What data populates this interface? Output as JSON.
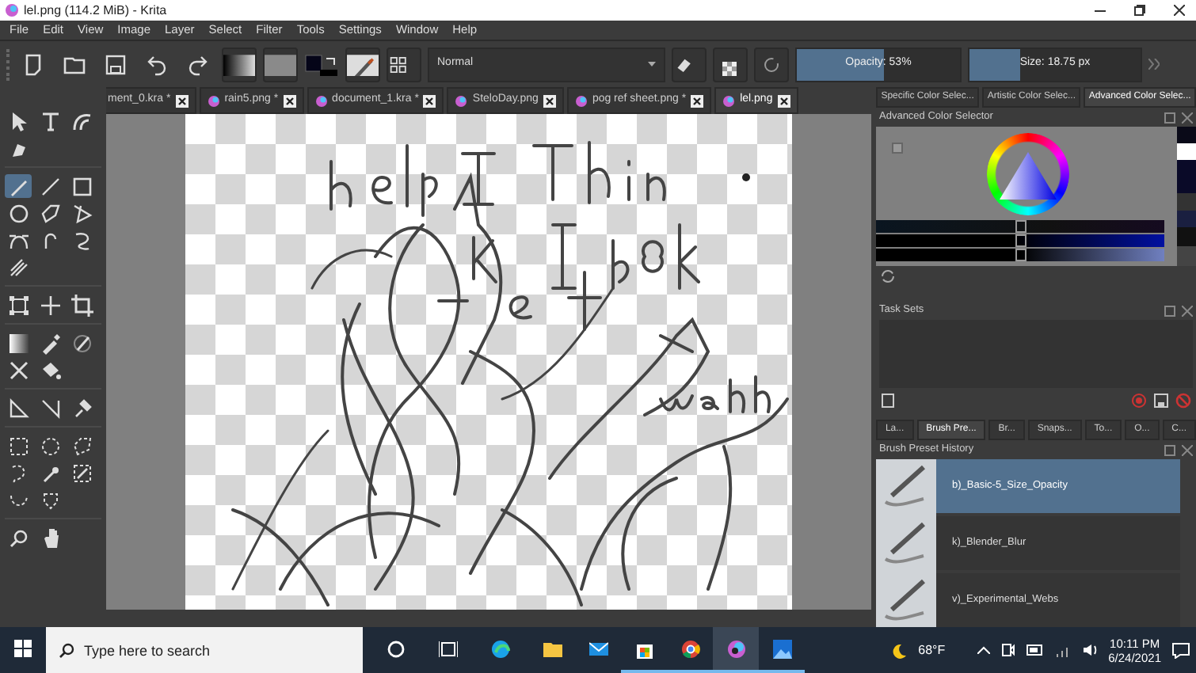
{
  "window": {
    "title": "lel.png (114.2 MiB)  - Krita"
  },
  "menu": [
    "File",
    "Edit",
    "View",
    "Image",
    "Layer",
    "Select",
    "Filter",
    "Tools",
    "Settings",
    "Window",
    "Help"
  ],
  "toolbar": {
    "blend_mode": "Normal",
    "opacity": {
      "label": "Opacity: 53%",
      "level": 0.53
    },
    "size": {
      "label": "Size: 18.75 px",
      "level": 0.3
    }
  },
  "document_tabs": [
    {
      "label": "ment_0.kra *",
      "selected": false
    },
    {
      "label": "rain5.png *",
      "selected": false
    },
    {
      "label": "document_1.kra *",
      "selected": false
    },
    {
      "label": "SteloDay.png",
      "selected": false
    },
    {
      "label": "pog ref sheet.png *",
      "selected": false
    },
    {
      "label": "lel.png",
      "selected": true
    }
  ],
  "tool_groups": [
    [
      {
        "selected": false
      },
      {
        "selected": false
      },
      {
        "selected": false
      },
      {
        "selected": false
      }
    ],
    [
      {
        "selected": true
      },
      {
        "selected": false
      },
      {
        "selected": false
      },
      {
        "selected": false
      },
      {
        "selected": false
      },
      {
        "selected": false
      },
      {
        "selected": false
      },
      {
        "selected": false
      },
      {
        "selected": false
      },
      {
        "selected": false
      }
    ],
    [
      {
        "selected": false
      },
      {
        "selected": false
      },
      {
        "selected": false
      }
    ],
    [
      {
        "selected": false
      },
      {
        "selected": false
      },
      {
        "selected": false
      },
      {
        "selected": false
      },
      {
        "selected": false
      }
    ],
    [
      {
        "selected": false
      },
      {
        "selected": false
      },
      {
        "selected": false
      }
    ],
    [
      {
        "selected": false
      },
      {
        "selected": false
      },
      {
        "selected": false
      },
      {
        "selected": false
      },
      {
        "selected": false
      },
      {
        "selected": false
      },
      {
        "selected": false
      },
      {
        "selected": false
      }
    ],
    [
      {
        "selected": false
      },
      {
        "selected": false
      }
    ]
  ],
  "color_tabs": [
    {
      "label": "Specific Color Selec...",
      "selected": false
    },
    {
      "label": "Artistic Color Selec...",
      "selected": false
    },
    {
      "label": "Advanced Color Selec...",
      "selected": true
    }
  ],
  "color_panel": {
    "title": "Advanced Color Selector",
    "sliders": [
      {
        "level": 0.5
      },
      {
        "level": 0.5
      },
      {
        "level": 0.5
      }
    ]
  },
  "task_sets": {
    "title": "Task Sets"
  },
  "dock_tabs": [
    {
      "label": "La...",
      "selected": false
    },
    {
      "label": "Brush Pre...",
      "selected": true
    },
    {
      "label": "Br...",
      "selected": false
    },
    {
      "label": "Snaps...",
      "selected": false
    },
    {
      "label": "To...",
      "selected": false
    },
    {
      "label": "O...",
      "selected": false
    },
    {
      "label": "C...",
      "selected": false
    }
  ],
  "preset_history": {
    "title": "Brush Preset History",
    "presets": [
      {
        "label": "b)_Basic-5_Size_Opacity",
        "selected": true
      },
      {
        "label": "k)_Blender_Blur",
        "selected": false
      },
      {
        "label": "v)_Experimental_Webs",
        "selected": false
      }
    ]
  },
  "taskbar": {
    "search": {
      "placeholder": "Type here to search"
    },
    "apps": [
      {
        "running": false,
        "selected": false
      },
      {
        "running": false,
        "selected": false
      },
      {
        "running": false,
        "selected": false
      },
      {
        "running": false,
        "selected": false
      },
      {
        "running": true,
        "selected": false
      },
      {
        "running": true,
        "selected": false
      },
      {
        "running": true,
        "selected": true
      },
      {
        "running": true,
        "selected": false
      }
    ],
    "weather": "68°F",
    "time": "10:11 PM",
    "date": "6/24/2021"
  }
}
